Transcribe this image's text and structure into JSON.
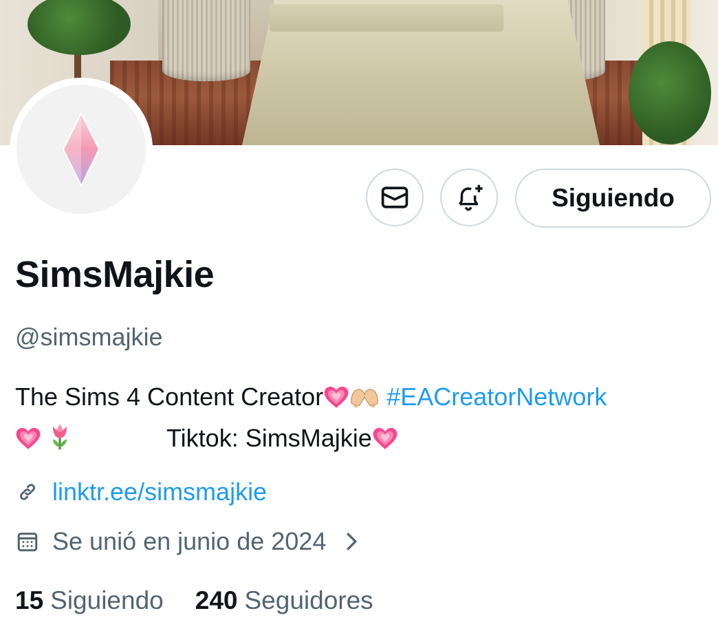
{
  "profile": {
    "display_name": "SimsMajkie",
    "handle": "@simsmajkie",
    "bio": {
      "line1_text": "The Sims 4 Content Creator",
      "hashtag": "#EACreatorNetwork",
      "line2_text": "Tiktok: SimsMajkie",
      "emojis": [
        "growing-heart",
        "heart-hands",
        "growing-heart",
        "tulip",
        "growing-heart"
      ]
    },
    "website": "linktr.ee/simsmajkie",
    "joined": "Se unió en junio de 2024"
  },
  "actions": {
    "message_icon": "envelope-icon",
    "notify_icon": "bell-plus-icon",
    "follow_label": "Siguiendo"
  },
  "stats": {
    "following_count": "15",
    "following_label": "Siguiendo",
    "followers_count": "240",
    "followers_label": "Seguidores"
  },
  "colors": {
    "text_primary": "#0f1419",
    "text_secondary": "#536471",
    "link": "#1d9bf0",
    "border": "#cfd9de"
  }
}
